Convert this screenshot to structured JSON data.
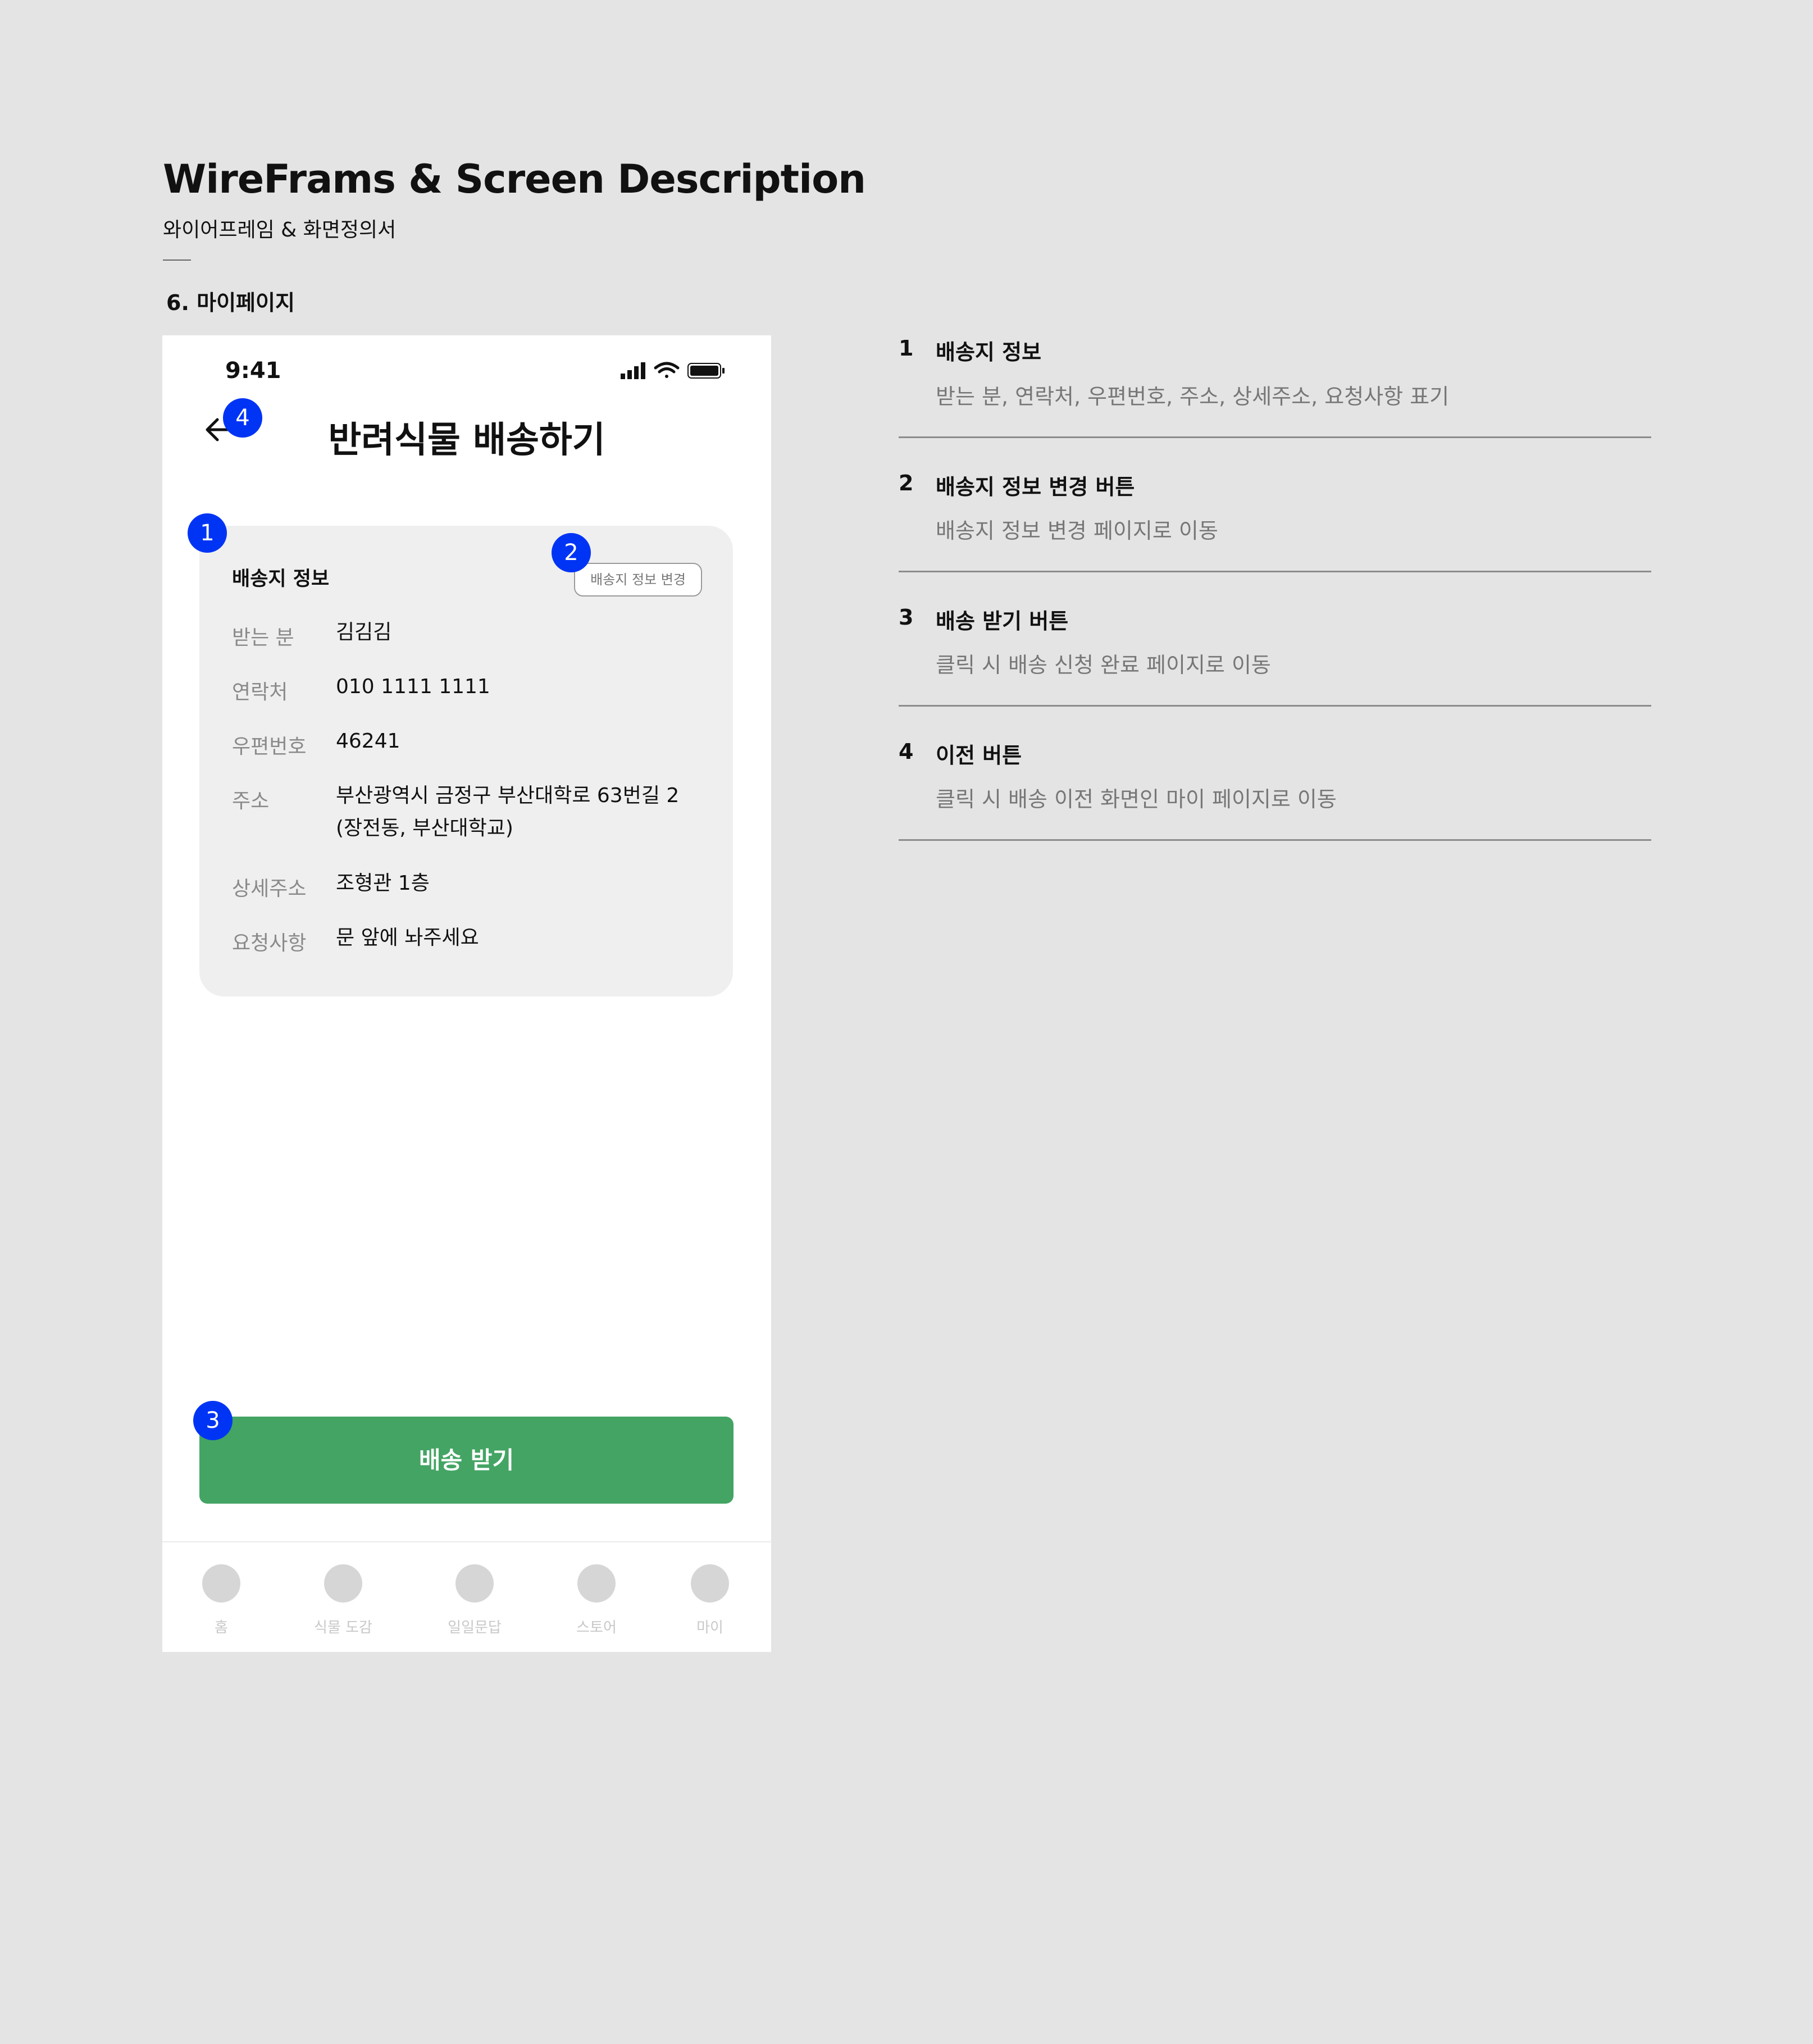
{
  "doc": {
    "title": "WireFrams & Screen Description",
    "subtitle": "와이어프레임 & 화면정의서",
    "section": "6. 마이페이지"
  },
  "phone": {
    "status_time": "9:41",
    "screen_title": "반려식물 배송하기",
    "card": {
      "title": "배송지 정보",
      "change_button": "배송지 정보 변경",
      "rows": [
        {
          "label": "받는 분",
          "value": "김김김"
        },
        {
          "label": "연락처",
          "value": "010 1111 1111"
        },
        {
          "label": "우편번호",
          "value": "46241"
        },
        {
          "label": "주소",
          "value": "부산광역시 금정구 부산대학로 63번길 2",
          "value2": "(장전동, 부산대학교)"
        },
        {
          "label": "상세주소",
          "value": "조형관 1층"
        },
        {
          "label": "요청사항",
          "value": "문 앞에 놔주세요"
        }
      ]
    },
    "cta_label": "배송 받기",
    "tabs": [
      "홈",
      "식물 도감",
      "일일문답",
      "스토어",
      "마이"
    ],
    "badges": [
      "1",
      "2",
      "3",
      "4"
    ]
  },
  "descriptions": [
    {
      "num": "1",
      "title": "배송지 정보",
      "text": "받는 분, 연락처, 우편번호, 주소, 상세주소, 요청사항 표기"
    },
    {
      "num": "2",
      "title": "배송지 정보 변경 버튼",
      "text": "배송지 정보 변경 페이지로 이동"
    },
    {
      "num": "3",
      "title": "배송 받기 버튼",
      "text": "클릭 시 배송 신청 완료 페이지로 이동"
    },
    {
      "num": "4",
      "title": "이전 버튼",
      "text": "클릭 시 배송 이전 화면인 마이 페이지로 이동"
    }
  ],
  "colors": {
    "badge": "#0034f5",
    "cta": "#44a464",
    "background": "#e4e4e4"
  }
}
